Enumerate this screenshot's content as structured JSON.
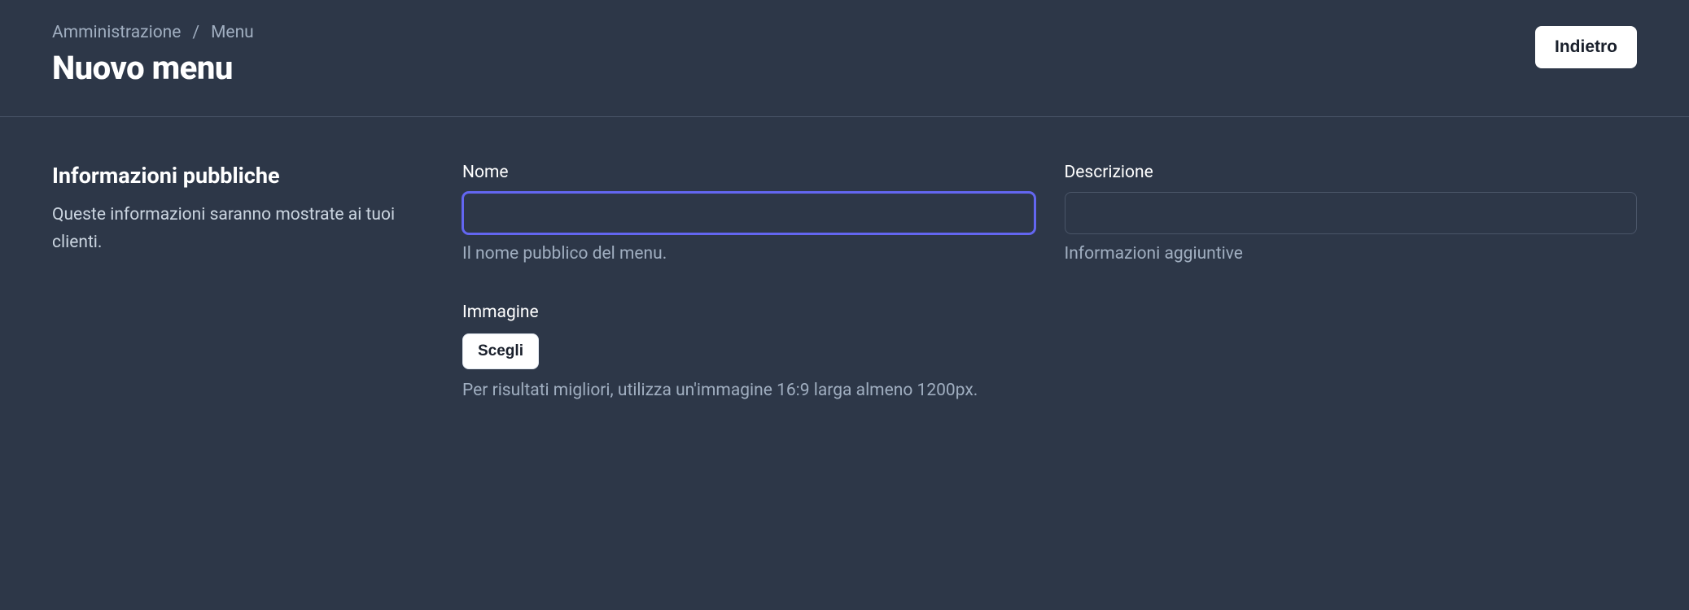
{
  "breadcrumb": {
    "root": "Amministrazione",
    "separator": "/",
    "current": "Menu"
  },
  "page_title": "Nuovo menu",
  "back_button": "Indietro",
  "section": {
    "title": "Informazioni pubbliche",
    "description": "Queste informazioni saranno mostrate ai tuoi clienti."
  },
  "fields": {
    "name": {
      "label": "Nome",
      "value": "",
      "hint": "Il nome pubblico del menu."
    },
    "description": {
      "label": "Descrizione",
      "value": "",
      "hint": "Informazioni aggiuntive"
    },
    "image": {
      "label": "Immagine",
      "button": "Scegli",
      "hint": "Per risultati migliori, utilizza un'immagine 16:9 larga almeno 1200px."
    }
  }
}
